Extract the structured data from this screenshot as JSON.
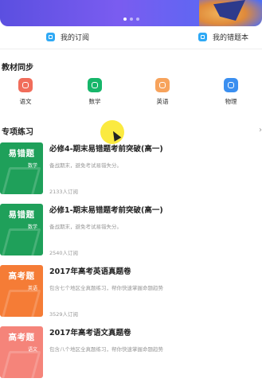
{
  "quick_links": [
    {
      "label": "我的订阅",
      "icon": "subscription-icon"
    },
    {
      "label": "我的错题本",
      "icon": "notebook-icon"
    }
  ],
  "sections": {
    "sync_title": "教材同步",
    "special_title": "专项练习",
    "more_arrow": "›"
  },
  "subjects": [
    {
      "label": "语文",
      "icon": "chinese-icon",
      "color": "#f16d5b"
    },
    {
      "label": "数学",
      "icon": "math-icon",
      "color": "#16b66a"
    },
    {
      "label": "英语",
      "icon": "english-icon",
      "color": "#f7a35c"
    },
    {
      "label": "物理",
      "icon": "physics-icon",
      "color": "#3b8ff0"
    }
  ],
  "cards": [
    {
      "cover_title": "易错题",
      "cover_sub": "数学",
      "title": "必修4-期末易错题考前突破(高一)",
      "desc": "备战期末，避免考试易错失分。",
      "count": "2133人订阅",
      "color": "#1fa05a"
    },
    {
      "cover_title": "易错题",
      "cover_sub": "数学",
      "title": "必修1-期末易错题考前突破(高一)",
      "desc": "备战期末，避免考试易错失分。",
      "count": "2540人订阅",
      "color": "#1fa05a"
    },
    {
      "cover_title": "高考题",
      "cover_sub": "英语",
      "title": "2017年高考英语真题卷",
      "desc": "包含七个地区全真题练习，帮你快速掌握命题趋势",
      "count": "3529人订阅",
      "color": "#f57c36"
    },
    {
      "cover_title": "高考题",
      "cover_sub": "语文",
      "title": "2017年高考语文真题卷",
      "desc": "包含八个地区全真题练习，帮你快速掌握命题趋势",
      "count": "",
      "color": "#f5847a"
    }
  ]
}
